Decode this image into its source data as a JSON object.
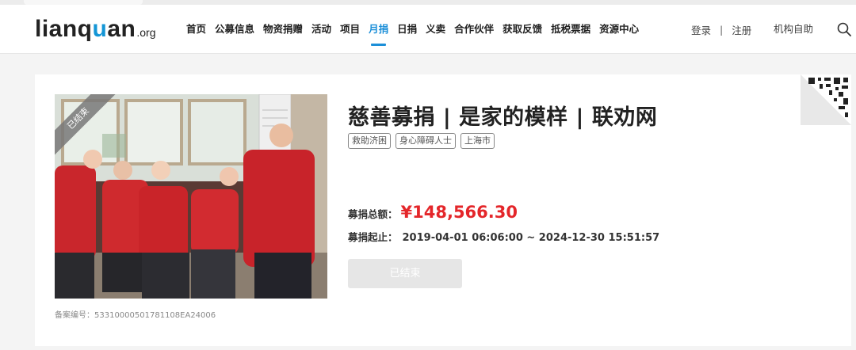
{
  "logo": {
    "text_main": "lianq",
    "text_accent": "u",
    "text_rest": "an",
    "suffix": ".org"
  },
  "nav": {
    "items": [
      {
        "label": "首页"
      },
      {
        "label": "公募信息"
      },
      {
        "label": "物资捐赠"
      },
      {
        "label": "活动"
      },
      {
        "label": "项目"
      },
      {
        "label": "月捐",
        "active": true
      },
      {
        "label": "日捐"
      },
      {
        "label": "义卖"
      },
      {
        "label": "合作伙伴"
      },
      {
        "label": "获取反馈"
      },
      {
        "label": "抵税票据"
      },
      {
        "label": "资源中心"
      }
    ],
    "login": "登录",
    "separator": "|",
    "register": "注册",
    "self_help": "机构自助",
    "search_icon": "search-icon"
  },
  "project": {
    "ribbon": "已结束",
    "title": "慈善募捐 | 是家的模样  | 联劝网",
    "tags": [
      "救助济困",
      "身心障碍人士",
      "上海市"
    ],
    "amount_label": "募捐总额：",
    "amount": "¥148,566.30",
    "period_label": "募捐起止：",
    "period": "2019-04-01 06:06:00 ~ 2024-12-30 15:51:57",
    "status_button": "已结束",
    "record_number": "备案编号：53310000501781108EA24006"
  },
  "colors": {
    "accent": "#1c8fd8",
    "amount": "#e4262a",
    "disabled_button": "#e6e6e6"
  }
}
